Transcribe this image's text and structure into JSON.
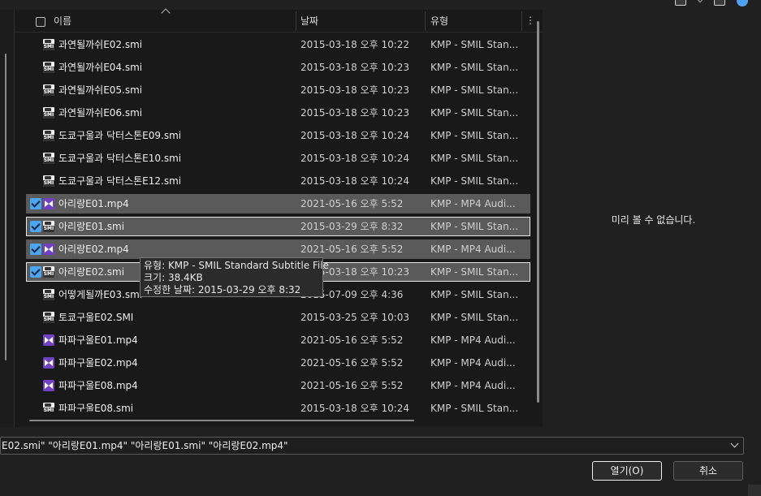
{
  "header": {
    "col_name": "이름",
    "col_date": "날짜",
    "col_type": "유형",
    "more": "⋮"
  },
  "files": [
    {
      "name": "과연될까쉬E02.smi",
      "date": "2015-03-18 오후 10:22",
      "type": "KMP - SMIL Stan...",
      "icon": "smi-file-icon",
      "selected": false
    },
    {
      "name": "과연될까쉬E04.smi",
      "date": "2015-03-18 오후 10:23",
      "type": "KMP - SMIL Stan...",
      "icon": "smi-file-icon",
      "selected": false
    },
    {
      "name": "과연될까쉬E05.smi",
      "date": "2015-03-18 오후 10:23",
      "type": "KMP - SMIL Stan...",
      "icon": "smi-file-icon",
      "selected": false
    },
    {
      "name": "과연될까쉬E06.smi",
      "date": "2015-03-18 오후 10:23",
      "type": "KMP - SMIL Stan...",
      "icon": "smi-file-icon",
      "selected": false
    },
    {
      "name": "도쿄구울과 닥터스톤E09.smi",
      "date": "2015-03-18 오후 10:24",
      "type": "KMP - SMIL Stan...",
      "icon": "smi-file-icon",
      "selected": false
    },
    {
      "name": "도쿄구울과 닥터스톤E10.smi",
      "date": "2015-03-18 오후 10:24",
      "type": "KMP - SMIL Stan...",
      "icon": "smi-file-icon",
      "selected": false
    },
    {
      "name": "도쿄구울과 닥터스톤E12.smi",
      "date": "2015-03-18 오후 10:24",
      "type": "KMP - SMIL Stan...",
      "icon": "smi-file-icon",
      "selected": false
    },
    {
      "name": "아리랑E01.mp4",
      "date": "2021-05-16 오후 5:52",
      "type": "KMP - MP4 Audi...",
      "icon": "mp4-file-icon",
      "selected": true
    },
    {
      "name": "아리랑E01.smi",
      "date": "2015-03-29 오후 8:32",
      "type": "KMP - SMIL Stan...",
      "icon": "smi-file-icon",
      "selected": true
    },
    {
      "name": "아리랑E02.mp4",
      "date": "2021-05-16 오후 5:52",
      "type": "KMP - MP4 Audi...",
      "icon": "mp4-file-icon",
      "selected": true
    },
    {
      "name": "아리랑E02.smi",
      "date": "2015-03-18 오후 10:23",
      "type": "KMP - SMIL Stan...",
      "icon": "smi-file-icon",
      "selected": true
    },
    {
      "name": "어떻게될까E03.smi",
      "date": "2015-07-09 오후 4:36",
      "type": "KMP - SMIL Stan...",
      "icon": "smi-file-icon",
      "selected": false
    },
    {
      "name": "토쿄구울E02.SMI",
      "date": "2015-03-25 오후 10:03",
      "type": "KMP - SMIL Stan...",
      "icon": "smi-file-icon",
      "selected": false
    },
    {
      "name": "파파구울E01.mp4",
      "date": "2021-05-16 오후 5:52",
      "type": "KMP - MP4 Audi...",
      "icon": "mp4-file-icon",
      "selected": false
    },
    {
      "name": "파파구울E02.mp4",
      "date": "2021-05-16 오후 5:52",
      "type": "KMP - MP4 Audi...",
      "icon": "mp4-file-icon",
      "selected": false
    },
    {
      "name": "파파구울E08.mp4",
      "date": "2021-05-16 오후 5:52",
      "type": "KMP - MP4 Audi...",
      "icon": "mp4-file-icon",
      "selected": false
    },
    {
      "name": "파파구울E08.smi",
      "date": "2015-03-18 오후 10:24",
      "type": "KMP - SMIL Stan...",
      "icon": "smi-file-icon",
      "selected": false
    }
  ],
  "tooltip": {
    "type_line": "유형: KMP - SMIL Standard Subtitle File",
    "size_line": "크기: 38.4KB",
    "modified_line": "수정한 날짜: 2015-03-29 오후 8:32"
  },
  "preview": {
    "message": "미리 볼 수 없습니다."
  },
  "footer": {
    "filename_value": "E02.smi\" \"아리랑E01.mp4\" \"아리랑E01.smi\" \"아리랑E02.mp4\"",
    "open_label": "열기(O)",
    "cancel_label": "취소"
  },
  "colors": {
    "selection": "#5a5a5a",
    "checkbox_accent": "#4ca5f0",
    "mp4_icon": "#6f42c1"
  }
}
